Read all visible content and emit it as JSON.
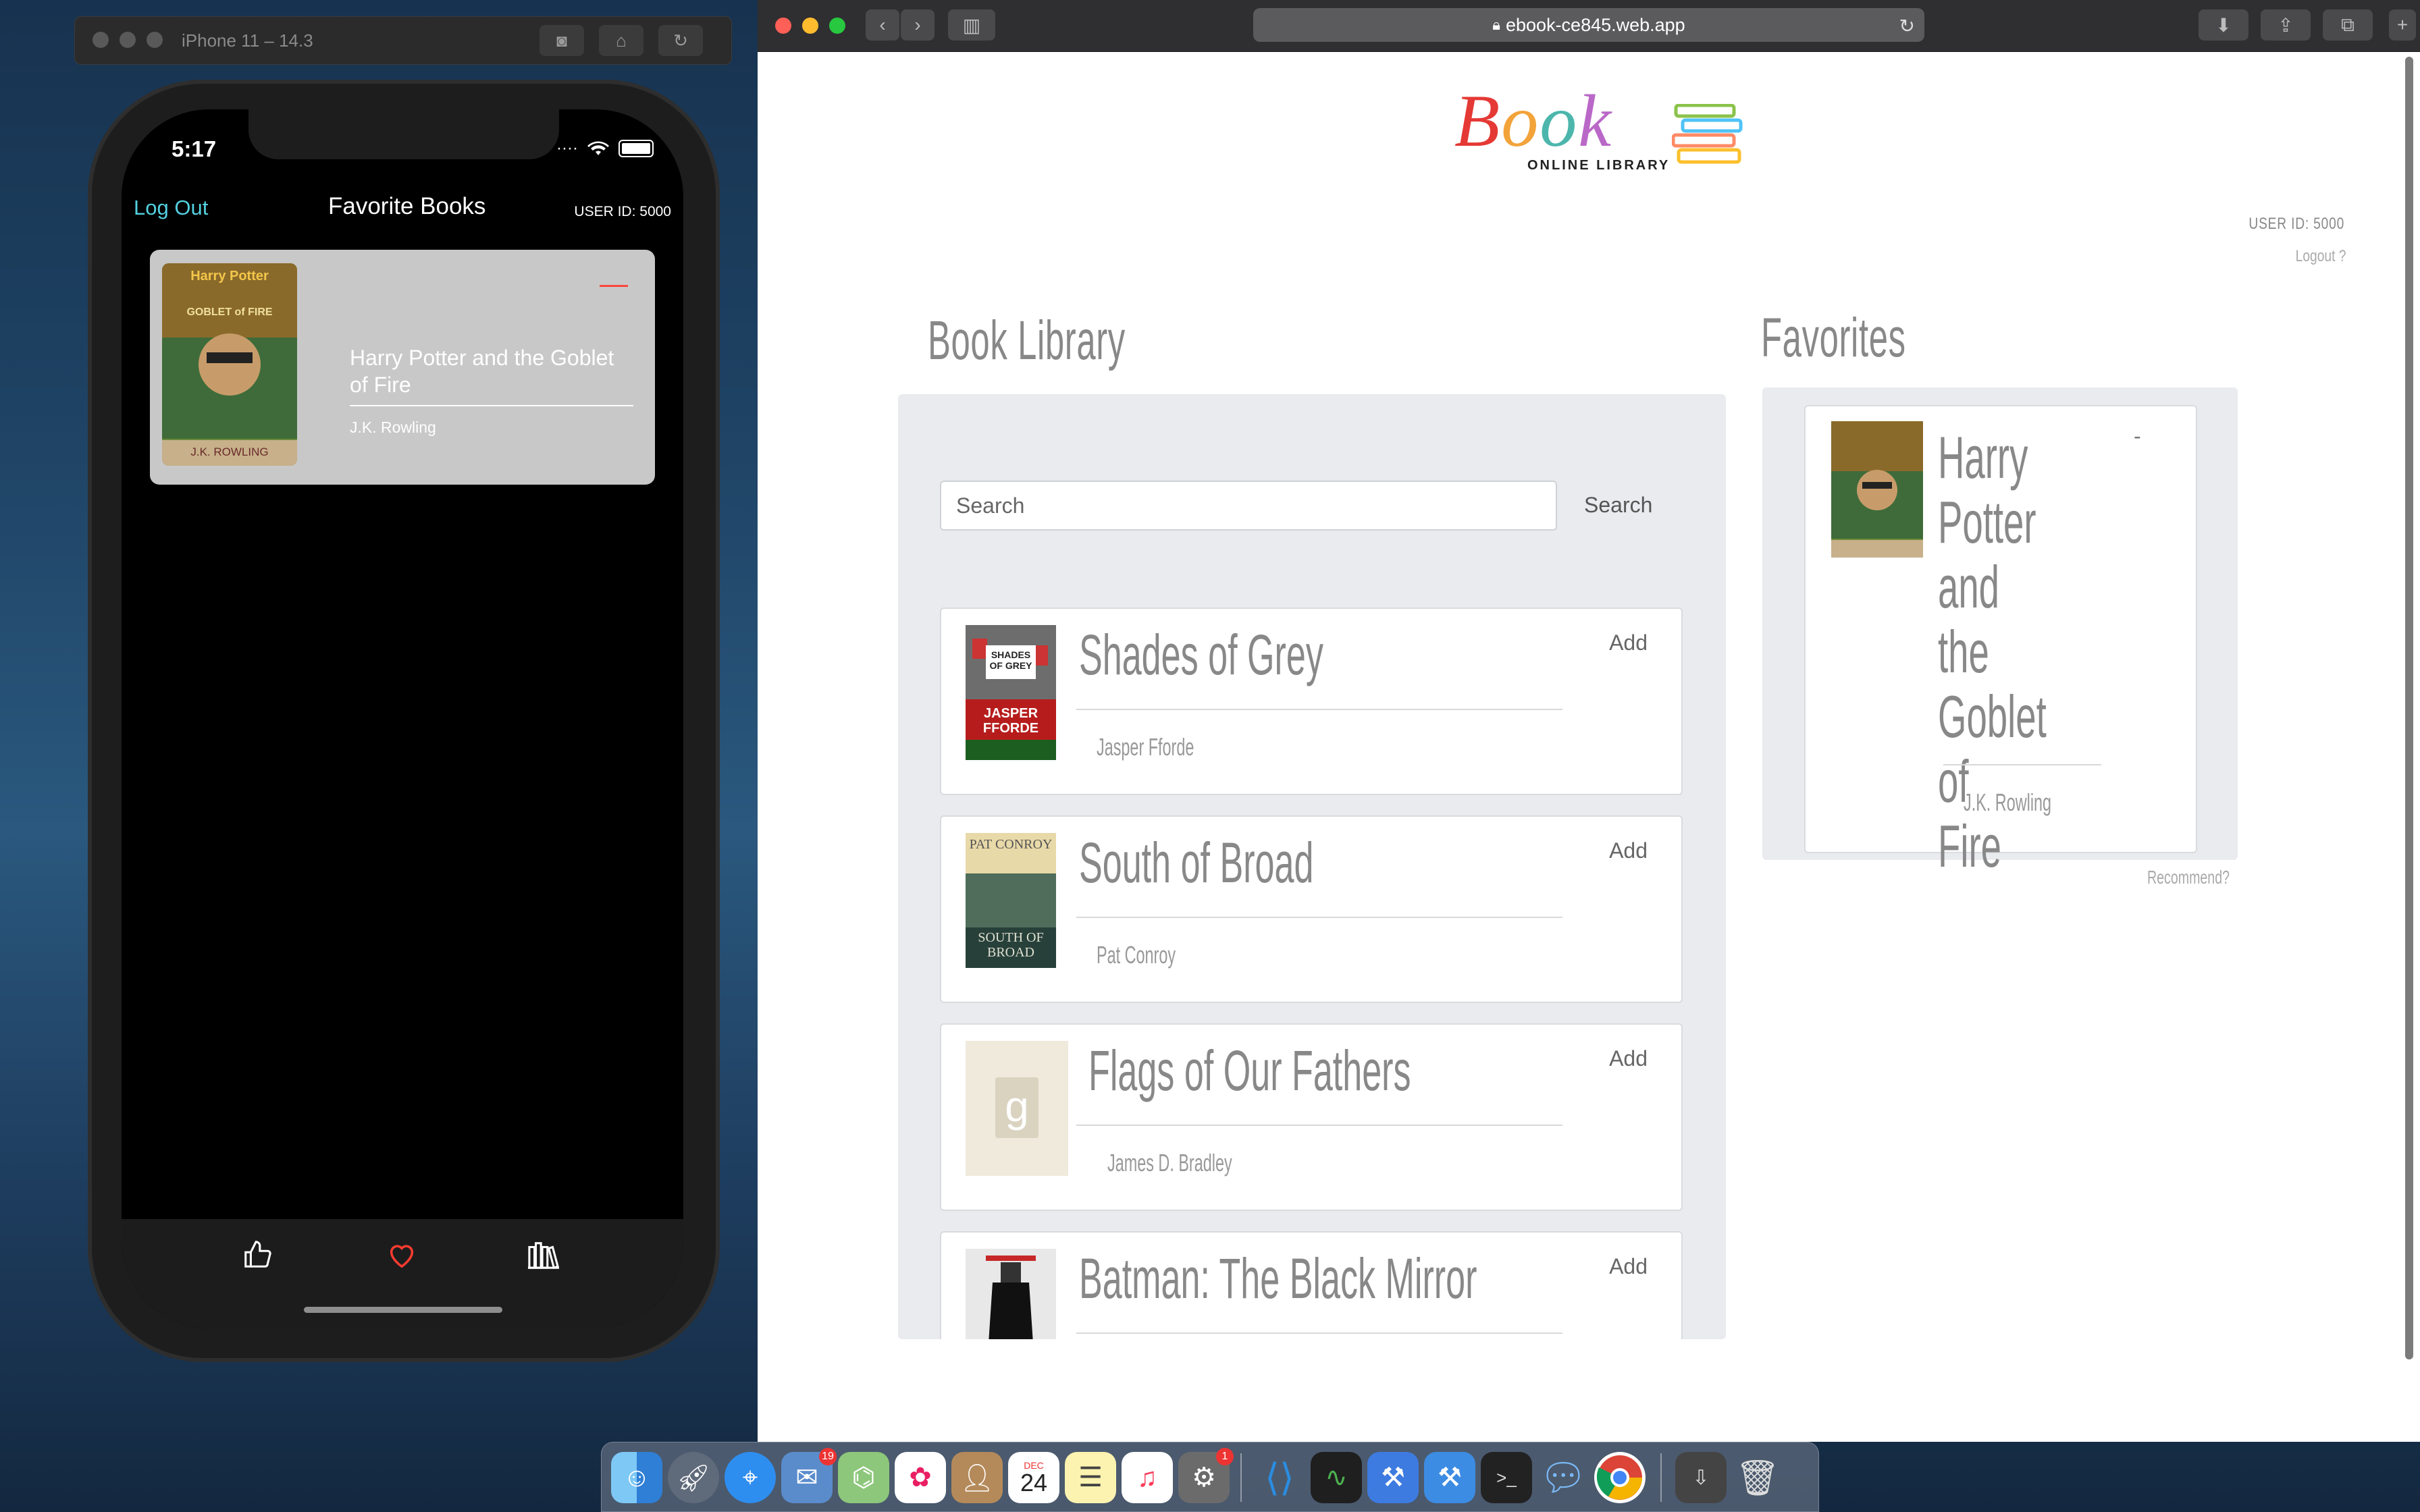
{
  "simulator": {
    "title": "iPhone 11 – 14.3",
    "toolbar_icons": [
      "screenshot-icon",
      "home-icon",
      "rotate-icon"
    ]
  },
  "phone": {
    "time": "5:17",
    "nav": {
      "logout_label": "Log Out",
      "title": "Favorite Books",
      "user_id": "USER ID: 5000"
    },
    "favorite": {
      "title": "Harry Potter and the Goblet of Fire",
      "author": "J.K. Rowling",
      "remove_label": "—",
      "cover_text_top": "Harry Potter",
      "cover_text_mid": "GOBLET of FIRE",
      "cover_text_bottom": "J.K. ROWLING"
    },
    "tabs": [
      {
        "icon": "thumbs-up-icon"
      },
      {
        "icon": "heart-icon",
        "active_color": "#ff3b30"
      },
      {
        "icon": "library-icon"
      }
    ]
  },
  "browser": {
    "url": "ebook-ce845.web.app",
    "logo": {
      "word": "Book",
      "sub": "ONLINE LIBRARY"
    },
    "user_id": "USER ID: 5000",
    "logout": "Logout ?",
    "library_heading": "Book Library",
    "favorites_heading": "Favorites",
    "search": {
      "placeholder": "Search",
      "button": "Search"
    },
    "books": [
      {
        "title": "Shades of Grey",
        "author": "Jasper Fforde",
        "add": "Add",
        "cover_top": "SHADES OF GREY",
        "cover_bottom": "JASPER FFORDE"
      },
      {
        "title": "South of Broad",
        "author": "Pat Conroy",
        "add": "Add",
        "cover_top": "PAT CONROY",
        "cover_bottom": "SOUTH OF BROAD"
      },
      {
        "title": "Flags of Our Fathers",
        "author": "James D. Bradley",
        "add": "Add",
        "cover_top": "g",
        "cover_bottom": ""
      },
      {
        "title": "Batman: The Black Mirror",
        "author": "",
        "add": "Add",
        "cover_top": "",
        "cover_bottom": ""
      }
    ],
    "favorite": {
      "title_lines": [
        "Harry",
        "Potter",
        "and the",
        "Goblet of",
        "Fire"
      ],
      "author": "J.K. Rowling",
      "remove": "-"
    },
    "recommend": "Recommend?"
  },
  "dock": {
    "apps": [
      "finder-icon",
      "launchpad-icon",
      "safari-icon",
      "mail-icon",
      "maps-icon",
      "photos-icon",
      "contacts-icon",
      "calendar-icon",
      "notes-icon",
      "music-icon",
      "system-preferences-icon",
      "vscode-icon",
      "activity-monitor-icon",
      "instruments-icon",
      "xcode-icon",
      "terminal-icon",
      "messages-icon",
      "chrome-icon",
      "downloads-icon",
      "trash-icon"
    ],
    "calendar_month": "DEC",
    "calendar_day": "24",
    "mail_badge": "19",
    "prefs_badge": "1"
  }
}
